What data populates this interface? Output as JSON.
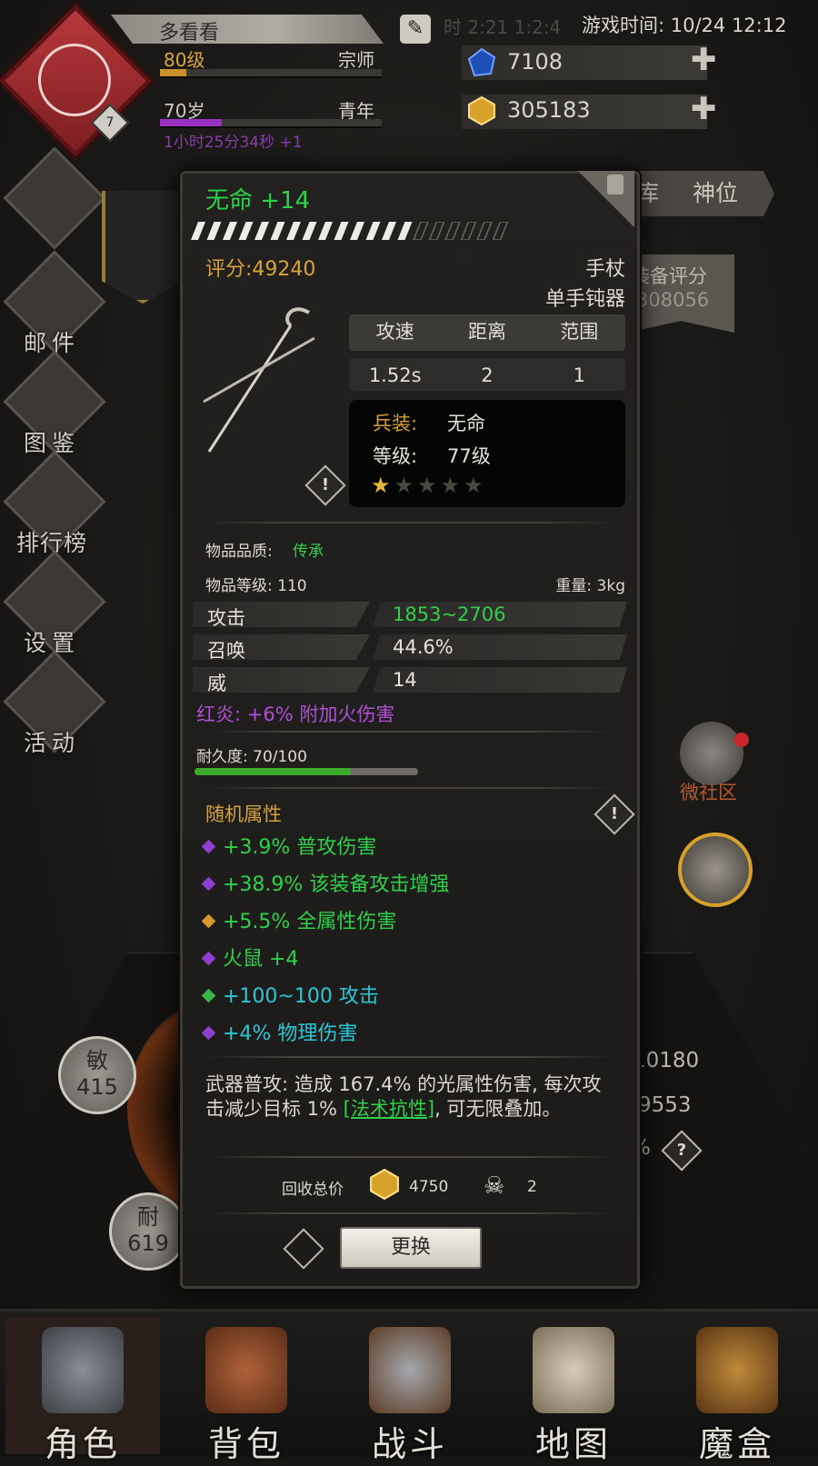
{
  "header": {
    "player_name": "多看看",
    "faded_text": "时 2:21 1:2:4",
    "game_time": "游戏时间: 10/24 12:12",
    "badge_level": "7",
    "level": "80级",
    "rank": "宗师",
    "age": "70岁",
    "age_stage": "青年",
    "timer": "1小时25分34秒 +1",
    "currency": [
      {
        "icon": "blue-gem-icon",
        "value": "7108"
      },
      {
        "icon": "gold-gem-icon",
        "value": "305183"
      }
    ]
  },
  "sidebar": {
    "items": [
      {
        "label": "邮件",
        "icon": "mail-icon"
      },
      {
        "label": "图鉴",
        "icon": "book-icon"
      },
      {
        "label": "排行榜",
        "icon": "ranking-icon"
      },
      {
        "label": "设置",
        "icon": "gear-icon"
      },
      {
        "label": "活动",
        "icon": "anvil-icon"
      }
    ]
  },
  "right": {
    "tabs": [
      "库",
      "神位"
    ],
    "equip_score_label": "装备评分",
    "equip_score_value": "308056",
    "community_label": "微社区",
    "stat1": "10180",
    "stat2": "9553",
    "stat_pct": "%"
  },
  "circles": [
    {
      "name": "敏",
      "value": "415"
    },
    {
      "name": "耐",
      "value": "619"
    }
  ],
  "item": {
    "name": "无命 +14",
    "score": "评分:49240",
    "type": "手杖",
    "subtype": "单手钝器",
    "table": {
      "headers": [
        "攻速",
        "距离",
        "范围"
      ],
      "values": [
        "1.52s",
        "2",
        "1"
      ]
    },
    "weapon_label": "兵装:",
    "weapon_value": "无命",
    "level_label": "等级:",
    "level_value": "77级",
    "stars_filled": 1,
    "stars_total": 5,
    "quality_label": "物品品质:",
    "quality_value": "传承",
    "item_level": "物品等级: 110",
    "weight": "重量: 3kg",
    "attrs": [
      {
        "key": "攻击",
        "value": "1853~2706",
        "color": "#2fd14a"
      },
      {
        "key": "召唤",
        "value": "44.6%",
        "color": "#e6e2da"
      },
      {
        "key": "威",
        "value": "14",
        "color": "#e6e2da"
      }
    ],
    "fire_text": "红炎: +6% 附加火伤害",
    "durability_label": "耐久度: 70/100",
    "durability_fraction": 0.7,
    "random_title": "随机属性",
    "random": [
      {
        "text": "+3.9% 普攻伤害",
        "color": "#2fd14a",
        "gem": "#8e3fd0"
      },
      {
        "text": "+38.9% 该装备攻击增强",
        "color": "#2fd14a",
        "gem": "#8e3fd0"
      },
      {
        "text": "+5.5% 全属性伤害",
        "color": "#2fd14a",
        "gem": "#d89a2a"
      },
      {
        "text": "火鼠 +4",
        "color": "#2fd14a",
        "gem": "#8e3fd0"
      },
      {
        "text": "+100~100 攻击",
        "color": "#2bc7d6",
        "gem": "#3ab54a"
      },
      {
        "text": "+4% 物理伤害",
        "color": "#2bc7d6",
        "gem": "#8e3fd0"
      }
    ],
    "desc_main": "武器普攻: 造成 167.4% 的光属性伤害, 每次攻击减少目标 1% ",
    "desc_link": "[法术抗性]",
    "desc_tail": ", 可无限叠加。",
    "recycle_label": "回收总价",
    "recycle_gold": "4750",
    "recycle_skull": "2",
    "replace_button": "更换"
  },
  "nav": [
    {
      "label": "角色",
      "icon": "helmet-icon"
    },
    {
      "label": "背包",
      "icon": "backpack-icon"
    },
    {
      "label": "战斗",
      "icon": "sword-shield-icon"
    },
    {
      "label": "地图",
      "icon": "scroll-icon"
    },
    {
      "label": "魔盒",
      "icon": "magic-box-icon"
    }
  ],
  "colors": {
    "accent_gold": "#d6a23c",
    "legend_green": "#2fd14a",
    "purple": "#b04fd6",
    "cyan": "#2bc7d6"
  }
}
